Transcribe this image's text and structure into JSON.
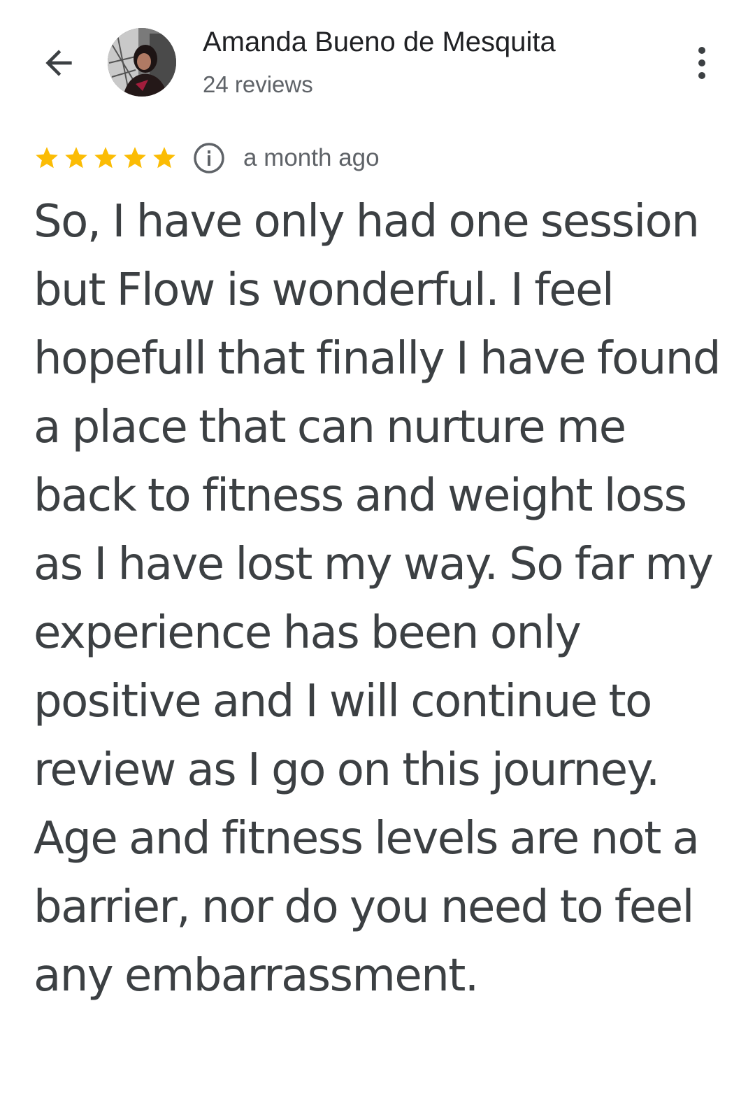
{
  "header": {
    "back_icon": "arrow-back-icon",
    "reviewer_name": "Amanda Bueno de Mesquita",
    "reviewer_meta": "24 reviews",
    "more_icon": "more-vert-icon"
  },
  "review": {
    "rating": 5,
    "rating_max": 5,
    "star_color": "#fbbc04",
    "info_icon": "info-icon",
    "timestamp": "a month ago",
    "text": "So, I have only had one session but Flow is wonderful. I feel hopefull that finally I have found a place that can nurture me back to fitness and weight loss as I have lost my way. So far my experience has been only positive and I will continue to review as I go on this journey. Age and fitness levels are not a barrier, nor do you need to feel any embarrassment."
  }
}
